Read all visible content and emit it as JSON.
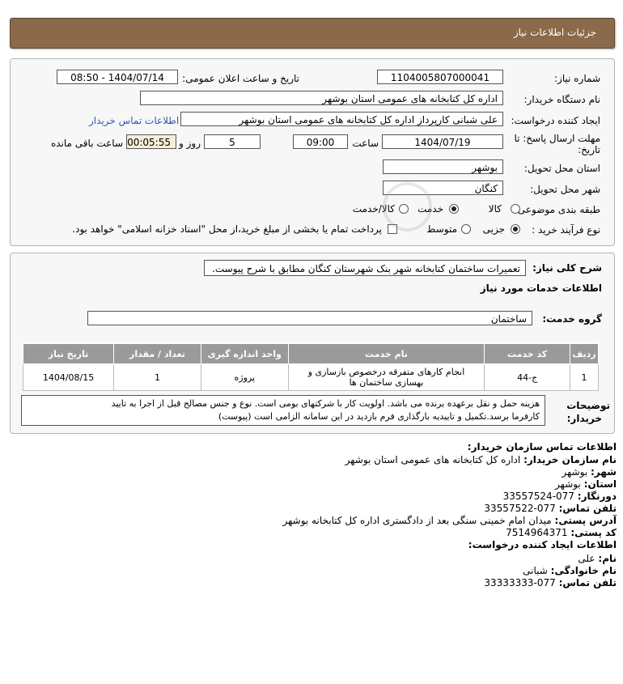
{
  "header": {
    "title": "جزئیات اطلاعات نیاز"
  },
  "form": {
    "need_number_label": "شماره نیاز:",
    "need_number": "1104005807000041",
    "announce_label": "تاریخ و ساعت اعلان عمومی:",
    "announce_value": "1404/07/14 - 08:50",
    "buyer_org_label": "نام دستگاه خریدار:",
    "buyer_org": "اداره کل کتابخانه های عمومی استان بوشهر",
    "creator_label": "ایجاد کننده درخواست:",
    "creator": "علی شبانی کارپرداز اداره کل کتابخانه های عمومی استان بوشهر",
    "contact_link": "اطلاعات تماس خریدار",
    "deadline_label_1": "مهلت ارسال پاسخ: تا",
    "deadline_label_2": "تاریخ:",
    "deadline_date": "1404/07/19",
    "time_label": "ساعت",
    "deadline_time": "09:00",
    "days_value": "5",
    "days_label": "روز و",
    "remaining_time": "00:05:55",
    "remaining_label": "ساعت باقی مانده",
    "province_label": "استان محل تحویل:",
    "province": "بوشهر",
    "city_label": "شهر محل تحویل:",
    "city": "کنگان",
    "category_label": "طبقه بندی موضوعی:",
    "category_options": [
      "کالا",
      "خدمت",
      "کالا/خدمت"
    ],
    "category_selected": "خدمت",
    "process_label": "نوع فرآیند خرید :",
    "process_options": [
      "جزیی",
      "متوسط"
    ],
    "process_selected": "جزیی",
    "payment_note": "پرداخت تمام یا بخشی از مبلغ خرید،از محل \"اسناد خزانه اسلامی\" خواهد بود."
  },
  "details": {
    "description_label": "شرح کلی نیاز:",
    "description": "تعمیرات ساختمان کتابخانه شهر بنک شهرستان کنگان مطابق با شرح پیوست.",
    "services_heading": "اطلاعات خدمات مورد نیاز",
    "service_group_label": "گروه خدمت:",
    "service_group": "ساختمان",
    "table": {
      "headers": [
        "ردیف",
        "کد خدمت",
        "نام خدمت",
        "واحد اندازه گیری",
        "تعداد / مقدار",
        "تاریخ نیاز"
      ],
      "rows": [
        [
          "1",
          "ج-44",
          "انجام کارهای متفرقه درخصوص بازسازی و بهسازی ساختمان ها",
          "پروژه",
          "1",
          "1404/08/15"
        ]
      ]
    },
    "buyer_notes_label_1": "توضیحات",
    "buyer_notes_label_2": "خریدار:",
    "buyer_notes_line1": "هزینه حمل و نقل برعهده برنده می باشد. اولویت کار با شرکتهای بومی است. نوع و جنس مصالح قبل از اجرا به تایید",
    "buyer_notes_line2": "کارفرما برسد.تکمیل و تاییدیه بارگذاری فرم بازدید در این سامانه الزامی است (پیوست)"
  },
  "contact": {
    "heading": "اطلاعات تماس سازمان خریدار:",
    "org_name_label": "نام سازمان خریدار:",
    "org_name": "اداره کل کتابخانه های عمومی استان بوشهر",
    "city_label": "شهر:",
    "city": "بوشهر",
    "province_label": "استان:",
    "province": "بوشهر",
    "fax_label": "دورنگار:",
    "fax": "077-33557524",
    "phone_label": "تلفن تماس:",
    "phone": "077-33557522",
    "address_label": "آدرس پستی:",
    "address": "میدان امام خمینی سنگی بعد از دادگستری اداره کل کتابخانه بوشهر",
    "postal_label": "کد پستی:",
    "postal": "7514964371",
    "creator_heading": "اطلاعات ایجاد کننده درخواست:",
    "first_name_label": "نام:",
    "first_name": "علی",
    "last_name_label": "نام خانوادگی:",
    "last_name": "شبانی",
    "creator_phone_label": "تلفن تماس:",
    "creator_phone": "077-33333333"
  }
}
